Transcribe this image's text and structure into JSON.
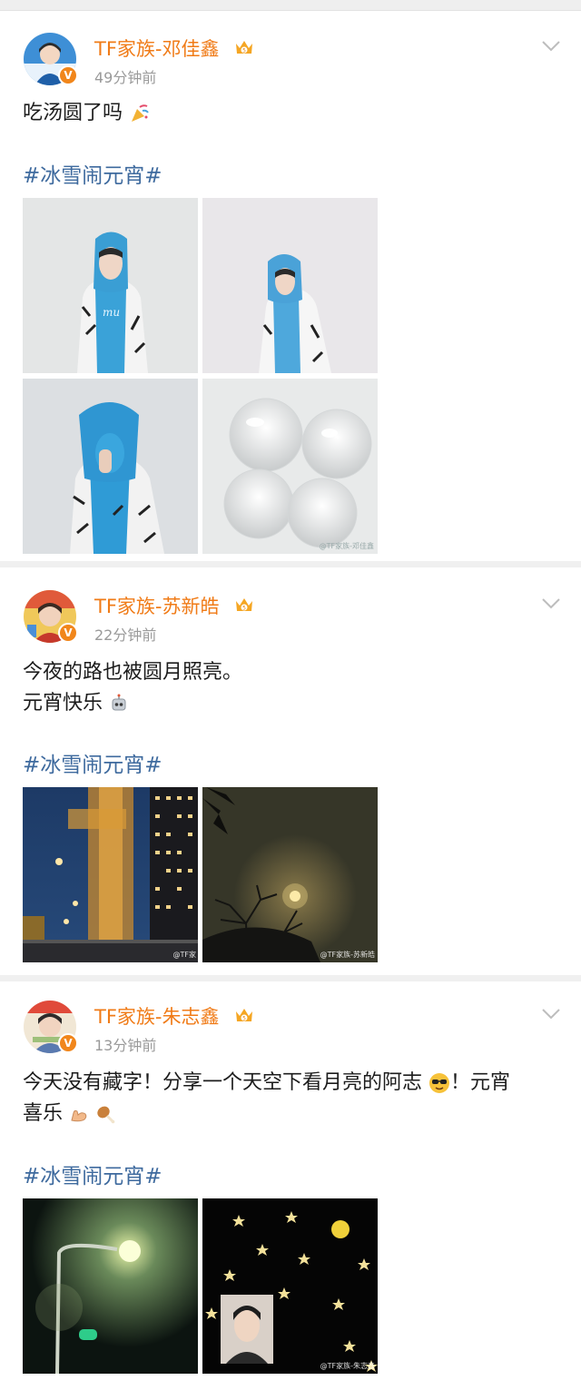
{
  "posts": [
    {
      "author": "TF家族-邓佳鑫",
      "vip_level": "5",
      "time": "49分钟前",
      "text_lines": [
        "吃汤圆了吗"
      ],
      "text_emoji": "party-popper-icon",
      "topic": "#冰雪闹元宵#",
      "photos": [
        "hoodie-portrait-1",
        "hoodie-portrait-2",
        "hoodie-portrait-3",
        "tangyuan-bowl"
      ],
      "watermark": "@TF家族-邓佳鑫"
    },
    {
      "author": "TF家族-苏新皓",
      "vip_level": "5",
      "time": "22分钟前",
      "text_lines": [
        "今夜的路也被圆月照亮。",
        "元宵快乐"
      ],
      "text_emoji": "robot-icon",
      "topic": "#冰雪闹元宵#",
      "photos": [
        "street-night",
        "moon-over-tree"
      ],
      "watermarks": [
        "@TF家",
        "@TF家族-苏新皓"
      ]
    },
    {
      "author": "TF家族-朱志鑫",
      "vip_level": "5",
      "time": "13分钟前",
      "text_lines": [
        "今天没有藏字！分享一个天空下看月亮的阿志",
        "！元宵",
        "喜乐"
      ],
      "text_emojis": [
        "sunglasses-face-icon",
        "flexed-biceps-icon",
        "drumstick-icon"
      ],
      "topic": "#冰雪闹元宵#",
      "photos": [
        "streetlight-night",
        "stars-and-moon"
      ],
      "watermark": "@TF家族-朱志鑫"
    }
  ],
  "colors": {
    "author": "#f07b17",
    "topic": "#3e6a9e",
    "time": "#9a9a9a",
    "badge": "#f1861b"
  }
}
